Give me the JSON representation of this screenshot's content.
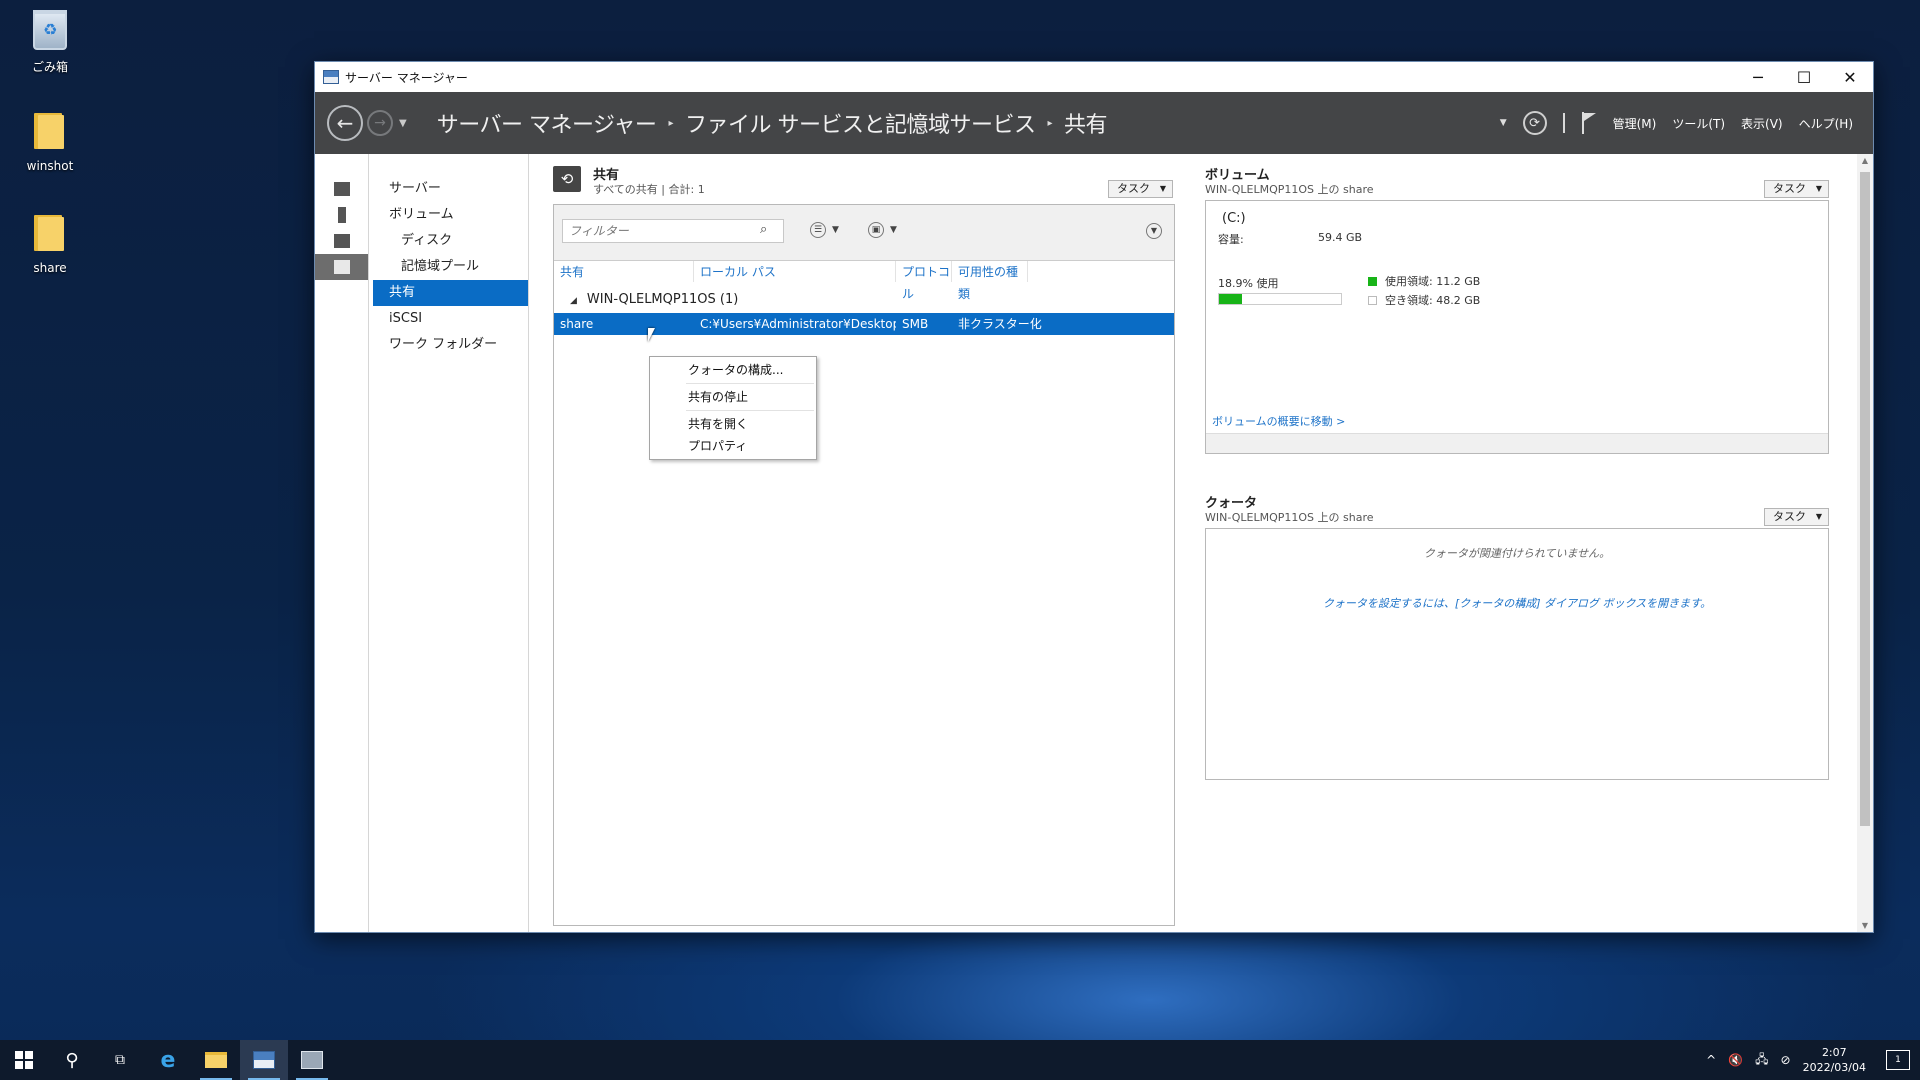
{
  "desktop": {
    "icons": [
      {
        "label": "ごみ箱"
      },
      {
        "label": "winshot"
      },
      {
        "label": "share"
      }
    ]
  },
  "window": {
    "title": "サーバー マネージャー",
    "controls": {
      "minimize": "─",
      "maximize": "☐",
      "close": "✕"
    }
  },
  "breadcrumb": {
    "items": [
      "サーバー マネージャー",
      "ファイル サービスと記憶域サービス",
      "共有"
    ],
    "separator": "▸"
  },
  "menu": {
    "manage": "管理(M)",
    "tools": "ツール(T)",
    "view": "表示(V)",
    "help": "ヘルプ(H)"
  },
  "nav": {
    "items": [
      {
        "label": "サーバー"
      },
      {
        "label": "ボリューム"
      },
      {
        "label": "ディスク"
      },
      {
        "label": "記憶域プール"
      },
      {
        "label": "共有"
      },
      {
        "label": "iSCSI"
      },
      {
        "label": "ワーク フォルダー"
      }
    ],
    "selected": "共有"
  },
  "shares": {
    "title": "共有",
    "subtitle": "すべての共有 | 合計: 1",
    "tasks": "タスク",
    "filter_placeholder": "フィルター",
    "columns": [
      "共有",
      "ローカル パス",
      "プロトコル",
      "可用性の種類"
    ],
    "group": "WIN-QLELMQP11OS (1)",
    "rows": [
      {
        "share": "share",
        "path": "C:¥Users¥Administrator¥Desktop¥...",
        "protocol": "SMB",
        "availability": "非クラスター化"
      }
    ]
  },
  "context_menu": {
    "items": [
      "クォータの構成...",
      "共有の停止",
      "共有を開く",
      "プロパティ"
    ]
  },
  "volume": {
    "title": "ボリューム",
    "subtitle": "WIN-QLELMQP11OS 上の share",
    "tasks": "タスク",
    "drive": "(C:)",
    "capacity_label": "容量:",
    "capacity_value": "59.4 GB",
    "usage_text": "18.9% 使用",
    "usage_fraction": 0.189,
    "used_legend": "使用領域: 11.2 GB",
    "free_legend": "空き領域: 48.2 GB",
    "used_color": "#18b418",
    "link": "ボリュームの概要に移動 >"
  },
  "quota": {
    "title": "クォータ",
    "subtitle": "WIN-QLELMQP11OS 上の share",
    "tasks": "タスク",
    "empty_text": "クォータが関連付けられていません。",
    "hint_text": "クォータを設定するには、[クォータの構成] ダイアログ ボックスを開きます。"
  },
  "taskbar": {
    "time": "2:07",
    "date": "2022/03/04",
    "notification_count": "1"
  }
}
